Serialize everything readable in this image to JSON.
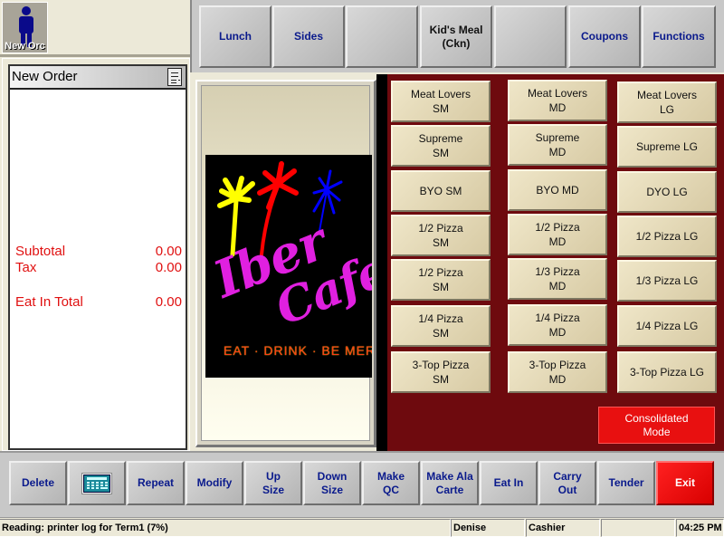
{
  "new_order_tile": {
    "label": "New Orc",
    "icon": "person-icon"
  },
  "top_buttons": [
    {
      "label": "Lunch",
      "style": "blue"
    },
    {
      "label": "Sides",
      "style": "blue"
    },
    {
      "label": "",
      "style": "blue"
    },
    {
      "label": "Kid's Meal (Ckn)",
      "style": "dark"
    },
    {
      "label": "",
      "style": "blue"
    },
    {
      "label": "Coupons",
      "style": "blue"
    },
    {
      "label": "Functions",
      "style": "blue"
    }
  ],
  "order_panel": {
    "title": "New Order",
    "icon": "receipt-icon",
    "totals": [
      {
        "label": "Subtotal",
        "value": "0.00"
      },
      {
        "label": "Tax",
        "value": "0.00"
      },
      {
        "label": "Eat In Total",
        "value": "0.00"
      }
    ]
  },
  "logo": {
    "title_1": "Iber",
    "title_2": "Cafe",
    "tagline": "EAT · DRINK · BE MERRY"
  },
  "menu_columns": [
    {
      "items": [
        "Meat Lovers SM",
        "Supreme SM",
        "BYO SM",
        "1/2 Pizza SM",
        "1/2 Pizza SM",
        "1/4 Pizza SM",
        "3-Top Pizza SM"
      ]
    },
    {
      "items": [
        "Meat Lovers MD",
        "Supreme MD",
        "BYO MD",
        "1/2 Pizza MD",
        "1/3 Pizza MD",
        "1/4 Pizza MD",
        "3-Top Pizza MD"
      ]
    },
    {
      "items": [
        "Meat Lovers LG",
        "Supreme LG",
        "DYO LG",
        "1/2 Pizza LG",
        "1/3 Pizza LG",
        "1/4 Pizza LG",
        "3-Top Pizza LG"
      ]
    }
  ],
  "consolidated_mode": {
    "label": "Consolidated Mode"
  },
  "bottom_buttons": [
    {
      "label": "Delete"
    },
    {
      "label": "",
      "icon": "calculator-icon"
    },
    {
      "label": "Repeat"
    },
    {
      "label": "Modify"
    },
    {
      "label": "Up Size"
    },
    {
      "label": "Down Size"
    },
    {
      "label": "Make QC"
    },
    {
      "label": "Make Ala Carte"
    },
    {
      "label": "Eat In"
    },
    {
      "label": "Carry Out"
    },
    {
      "label": "Tender"
    },
    {
      "label": "Exit"
    }
  ],
  "status_bar": {
    "message": "Reading: printer log for Term1 (7%)",
    "user": "Denise",
    "role": "Cashier",
    "blank": "",
    "time": "04:25 PM"
  },
  "colors": {
    "menu_background": "#6e0a0e",
    "exit_button": "#e81010",
    "totals_text": "#e01010",
    "nav_text": "#0a1a8c"
  }
}
